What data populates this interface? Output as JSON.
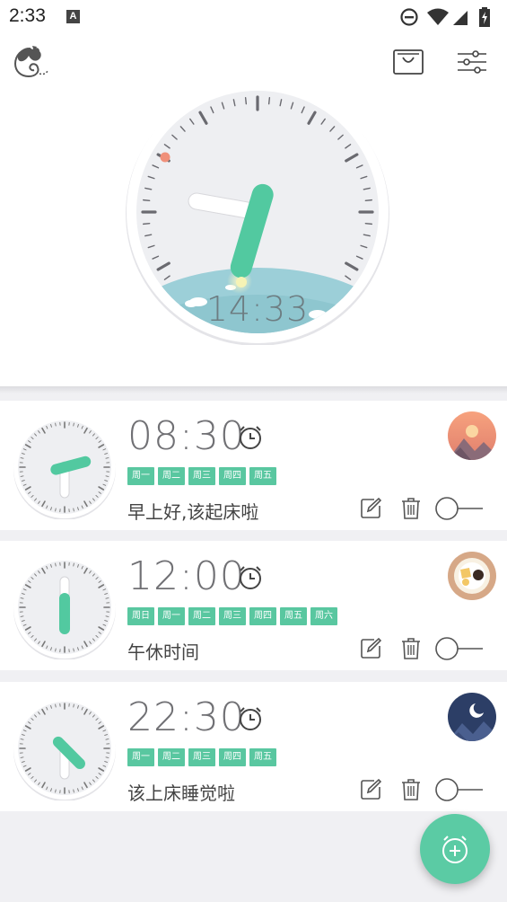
{
  "status_bar": {
    "time": "2:33",
    "notification_icon": "A",
    "icons": [
      "do-not-disturb-icon",
      "wifi-icon",
      "cell-signal-icon",
      "battery-charging-icon"
    ]
  },
  "header": {
    "logo_icon": "cat-logo-icon",
    "shop_icon": "shopping-bag-icon",
    "settings_icon": "sliders-icon",
    "clock_time": "14:33"
  },
  "alarms": [
    {
      "time": "08:30",
      "days": [
        "周一",
        "周二",
        "周三",
        "周四",
        "周五"
      ],
      "label": "早上好,该起床啦",
      "avatar": "sunrise-mountain",
      "enabled": false
    },
    {
      "time": "12:00",
      "days": [
        "周日",
        "周一",
        "周二",
        "周三",
        "周四",
        "周五",
        "周六"
      ],
      "label": "午休时间",
      "avatar": "lunch-plate",
      "enabled": false
    },
    {
      "time": "22:30",
      "days": [
        "周一",
        "周二",
        "周三",
        "周四",
        "周五"
      ],
      "label": "该上床睡觉啦",
      "avatar": "night-moon",
      "enabled": false
    }
  ],
  "colors": {
    "accent": "#59c7a0",
    "clock_face": "#eeeff2",
    "dot": "#f0907a",
    "sky": "#9ccfd8"
  },
  "fab_icon": "add-alarm-icon"
}
